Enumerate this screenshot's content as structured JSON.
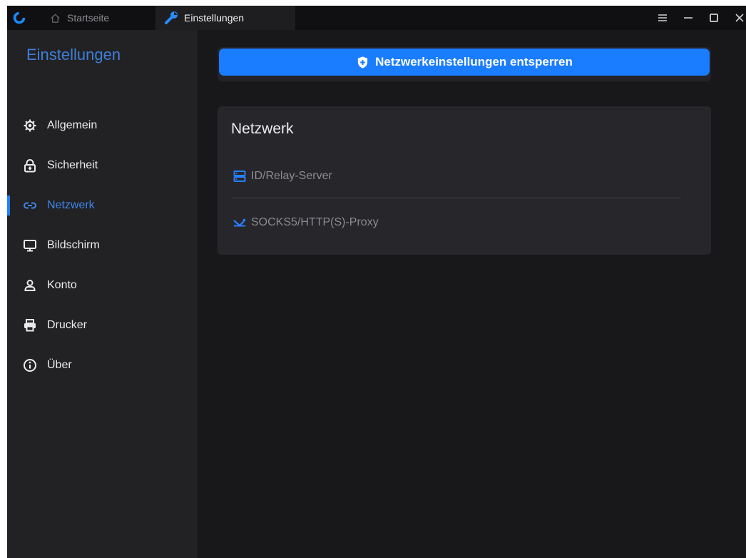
{
  "window": {
    "tabs": [
      {
        "label": "Startseite",
        "active": false,
        "icon": "home-icon"
      },
      {
        "label": "Einstellungen",
        "active": true,
        "icon": "wrench-icon"
      }
    ],
    "controls": [
      "menu-icon",
      "minimize-icon",
      "maximize-icon",
      "close-icon"
    ]
  },
  "sidebar": {
    "title": "Einstellungen",
    "items": [
      {
        "label": "Allgemein",
        "icon": "gear-icon",
        "active": false
      },
      {
        "label": "Sicherheit",
        "icon": "lock-icon",
        "active": false
      },
      {
        "label": "Netzwerk",
        "icon": "link-icon",
        "active": true
      },
      {
        "label": "Bildschirm",
        "icon": "monitor-icon",
        "active": false
      },
      {
        "label": "Konto",
        "icon": "person-icon",
        "active": false
      },
      {
        "label": "Drucker",
        "icon": "printer-icon",
        "active": false
      },
      {
        "label": "Über",
        "icon": "info-icon",
        "active": false
      }
    ]
  },
  "main": {
    "unlock_button": {
      "label": "Netzwerkeinstellungen entsperren",
      "icon": "shield-icon"
    },
    "network_card": {
      "title": "Netzwerk",
      "rows": [
        {
          "label": "ID/Relay-Server",
          "icon": "server-icon"
        },
        {
          "label": "SOCKS5/HTTP(S)-Proxy",
          "icon": "proxy-icon"
        }
      ]
    }
  },
  "colors": {
    "accent": "#1a7cff",
    "sidebar_title": "#3f7fd8",
    "active_nav": "#3f85ea",
    "background": "#18181b",
    "sidebar_bg": "#222225",
    "card_bg": "#27272b"
  }
}
